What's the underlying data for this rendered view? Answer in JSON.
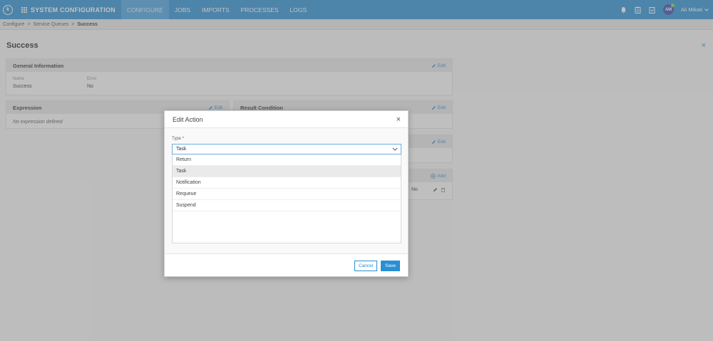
{
  "nav": {
    "logo": "k",
    "title": "SYSTEM CONFIGURATION",
    "tabs": [
      "CONFIGURE",
      "JOBS",
      "IMPORTS",
      "PROCESSES",
      "LOGS"
    ],
    "user_initials": "AM",
    "user_name": "Ali Mikati"
  },
  "breadcrumb": {
    "items": [
      "Configure",
      "Service Queues"
    ],
    "current": "Success",
    "separator": ">"
  },
  "page": {
    "title": "Success",
    "close": "×"
  },
  "general": {
    "title": "General Information",
    "edit": "Edit",
    "name_label": "Name",
    "name_value": "Success",
    "error_label": "Error",
    "error_value": "No"
  },
  "expression": {
    "title": "Expression",
    "edit": "Edit",
    "empty": "No expression defined"
  },
  "result": {
    "title": "Result Condition",
    "edit": "Edit"
  },
  "third_panel": {
    "edit": "Edit"
  },
  "actions_panel": {
    "add": "Add",
    "row_value": "No"
  },
  "modal": {
    "title": "Edit Action",
    "close": "×",
    "type_label": "Type",
    "required_mark": "*",
    "selected": "Task",
    "options": [
      "Return",
      "Task",
      "Notification",
      "Requeue",
      "Suspend"
    ],
    "cancel": "Cancel",
    "save": "Save"
  },
  "colors": {
    "primary": "#2b8fd4",
    "required": "#e0302a"
  }
}
